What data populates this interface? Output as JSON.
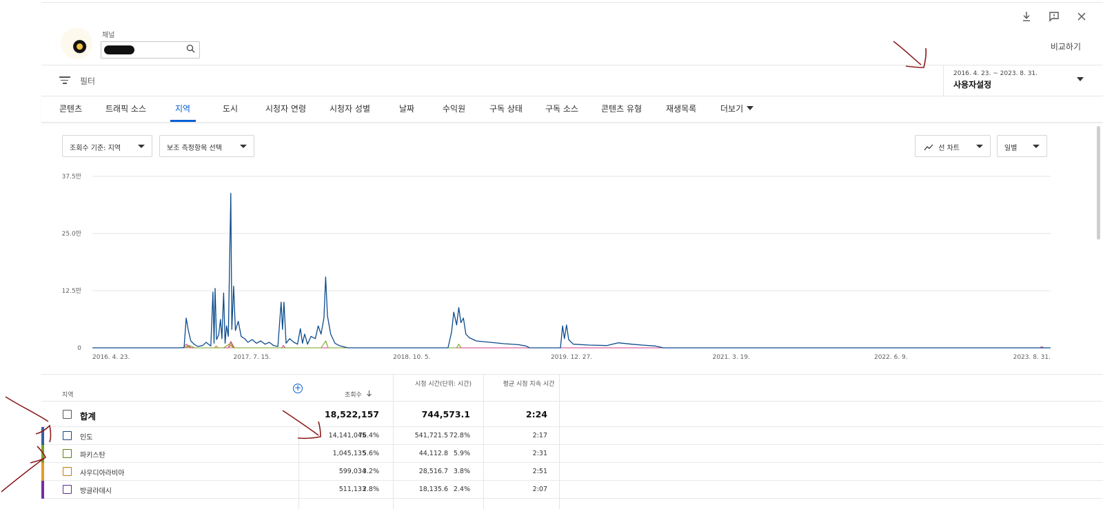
{
  "toolbar": {
    "download_icon": "download-icon",
    "feedback_icon": "feedback-icon",
    "close_icon": "close-icon"
  },
  "channel": {
    "label": "채널",
    "search_icon": "search-icon"
  },
  "compare_label": "비교하기",
  "filter": {
    "label": "필터"
  },
  "date_range": {
    "range": "2016. 4. 23. ~ 2023. 8. 31.",
    "preset": "사용자설정"
  },
  "tabs": [
    {
      "label": "콘텐츠"
    },
    {
      "label": "트래픽 소스"
    },
    {
      "label": "지역"
    },
    {
      "label": "도시"
    },
    {
      "label": "시청자 연령"
    },
    {
      "label": "시청자 성별"
    },
    {
      "label": "날짜"
    },
    {
      "label": "수익원"
    },
    {
      "label": "구독 상태"
    },
    {
      "label": "구독 소스"
    },
    {
      "label": "콘텐츠 유형"
    },
    {
      "label": "재생목록"
    },
    {
      "label": "더보기"
    }
  ],
  "active_tab": "지역",
  "controls": {
    "metric_select": "조회수 기준: 지역",
    "secondary_select": "보조 측정항목 선택",
    "chart_type_select": "선 차트",
    "interval_select": "일별"
  },
  "chart_data": {
    "type": "line",
    "y_ticks": [
      "0",
      "12.5만",
      "25.0만",
      "37.5만"
    ],
    "ylim": [
      0,
      375000
    ],
    "x_ticks": [
      "2016. 4. 23.",
      "2017. 7. 15.",
      "2018. 10. 5.",
      "2019. 12. 27.",
      "2021. 3. 19.",
      "2022. 6. 9.",
      "2023. 8. 31."
    ],
    "xlim": [
      "2016-04-23",
      "2023-08-31"
    ],
    "grid": true,
    "series": [
      {
        "color": "#0b4a8c",
        "points": [
          [
            "2016-04-23",
            0
          ],
          [
            "2016-12-20",
            0
          ],
          [
            "2017-01-05",
            500
          ],
          [
            "2017-01-11",
            65000
          ],
          [
            "2017-01-17",
            38000
          ],
          [
            "2017-01-24",
            15000
          ],
          [
            "2017-02-02",
            8000
          ],
          [
            "2017-02-12",
            3000
          ],
          [
            "2017-02-26",
            5000
          ],
          [
            "2017-03-08",
            12000
          ],
          [
            "2017-03-16",
            7000
          ],
          [
            "2017-03-21",
            4000
          ],
          [
            "2017-03-27",
            122000
          ],
          [
            "2017-03-30",
            10000
          ],
          [
            "2017-04-02",
            130000
          ],
          [
            "2017-04-06",
            18000
          ],
          [
            "2017-04-12",
            28000
          ],
          [
            "2017-04-17",
            62000
          ],
          [
            "2017-04-21",
            20000
          ],
          [
            "2017-04-26",
            120000
          ],
          [
            "2017-04-30",
            10000
          ],
          [
            "2017-05-04",
            48000
          ],
          [
            "2017-05-09",
            25000
          ],
          [
            "2017-05-16",
            338000
          ],
          [
            "2017-05-19",
            40000
          ],
          [
            "2017-05-24",
            135000
          ],
          [
            "2017-05-29",
            38000
          ],
          [
            "2017-06-06",
            58000
          ],
          [
            "2017-06-14",
            25000
          ],
          [
            "2017-06-24",
            20000
          ],
          [
            "2017-07-03",
            12000
          ],
          [
            "2017-07-15",
            18000
          ],
          [
            "2017-07-27",
            10000
          ],
          [
            "2017-08-08",
            15000
          ],
          [
            "2017-08-20",
            8000
          ],
          [
            "2017-09-01",
            12000
          ],
          [
            "2017-09-13",
            5000
          ],
          [
            "2017-09-25",
            3000
          ],
          [
            "2017-10-04",
            100000
          ],
          [
            "2017-10-08",
            40000
          ],
          [
            "2017-10-12",
            100000
          ],
          [
            "2017-10-18",
            10000
          ],
          [
            "2017-10-28",
            20000
          ],
          [
            "2017-11-09",
            12000
          ],
          [
            "2017-11-19",
            8000
          ],
          [
            "2017-11-27",
            42000
          ],
          [
            "2017-12-03",
            10000
          ],
          [
            "2017-12-09",
            30000
          ],
          [
            "2017-12-17",
            8000
          ],
          [
            "2017-12-27",
            25000
          ],
          [
            "2018-01-08",
            20000
          ],
          [
            "2018-01-16",
            48000
          ],
          [
            "2018-01-24",
            30000
          ],
          [
            "2018-02-01",
            65000
          ],
          [
            "2018-02-06",
            155000
          ],
          [
            "2018-02-11",
            70000
          ],
          [
            "2018-02-20",
            30000
          ],
          [
            "2018-03-04",
            10000
          ],
          [
            "2018-03-16",
            5000
          ],
          [
            "2018-03-30",
            2000
          ],
          [
            "2018-04-10",
            0
          ],
          [
            "2019-01-15",
            0
          ],
          [
            "2019-01-25",
            35000
          ],
          [
            "2019-01-31",
            78000
          ],
          [
            "2019-02-08",
            50000
          ],
          [
            "2019-02-14",
            88000
          ],
          [
            "2019-02-20",
            55000
          ],
          [
            "2019-02-27",
            65000
          ],
          [
            "2019-03-06",
            30000
          ],
          [
            "2019-03-16",
            22000
          ],
          [
            "2019-04-04",
            15000
          ],
          [
            "2019-05-13",
            12000
          ],
          [
            "2019-06-21",
            9000
          ],
          [
            "2019-07-31",
            7000
          ],
          [
            "2019-08-21",
            4000
          ],
          [
            "2019-09-01",
            0
          ],
          [
            "2019-11-26",
            0
          ],
          [
            "2019-12-02",
            48000
          ],
          [
            "2019-12-07",
            20000
          ],
          [
            "2019-12-13",
            50000
          ],
          [
            "2019-12-19",
            18000
          ],
          [
            "2020-01-01",
            8000
          ],
          [
            "2020-02-14",
            6000
          ],
          [
            "2020-04-04",
            5000
          ],
          [
            "2020-05-06",
            11000
          ],
          [
            "2020-06-12",
            8000
          ],
          [
            "2020-07-12",
            6000
          ],
          [
            "2020-08-17",
            4000
          ],
          [
            "2020-09-10",
            0
          ],
          [
            "2023-08-31",
            0
          ]
        ]
      },
      {
        "color": "#7aa21f",
        "points": [
          [
            "2017-01-11",
            0
          ],
          [
            "2017-01-20",
            5000
          ],
          [
            "2017-02-04",
            0
          ],
          [
            "2017-04-26",
            0
          ],
          [
            "2017-05-16",
            10000
          ],
          [
            "2017-05-24",
            0
          ],
          [
            "2018-01-24",
            0
          ],
          [
            "2018-02-06",
            15000
          ],
          [
            "2018-02-13",
            0
          ],
          [
            "2019-02-08",
            0
          ],
          [
            "2019-02-14",
            8000
          ],
          [
            "2019-02-21",
            0
          ]
        ]
      },
      {
        "color": "#d33f8a",
        "points": [
          [
            "2017-01-03",
            0
          ],
          [
            "2017-01-11",
            8000
          ],
          [
            "2017-01-25",
            0
          ],
          [
            "2017-05-09",
            0
          ],
          [
            "2017-05-16",
            14000
          ],
          [
            "2017-05-26",
            0
          ],
          [
            "2017-10-06",
            0
          ],
          [
            "2017-10-10",
            5000
          ],
          [
            "2017-10-16",
            0
          ],
          [
            "2023-08-01",
            0
          ],
          [
            "2023-08-06",
            2500
          ],
          [
            "2023-08-12",
            0
          ]
        ]
      },
      {
        "color": "#e07b1f",
        "points": [
          [
            "2017-01-06",
            0
          ],
          [
            "2017-01-14",
            4000
          ],
          [
            "2017-01-22",
            0
          ],
          [
            "2017-03-31",
            0
          ],
          [
            "2017-04-05",
            4000
          ],
          [
            "2017-04-11",
            0
          ],
          [
            "2017-05-11",
            0
          ],
          [
            "2017-05-16",
            6000
          ],
          [
            "2017-05-22",
            0
          ]
        ]
      }
    ]
  },
  "table": {
    "headers": {
      "dimension": "지역",
      "views": "조회수",
      "watch_time": "시청 시간(단위: 시간)",
      "avg_duration": "평균 시청 지속 시간"
    },
    "sort_icon": "arrow-down-icon",
    "add_icon": "add-circle-icon",
    "total": {
      "name": "합계",
      "views": "18,522,157",
      "watch_time": "744,573.1",
      "avg_duration": "2:24"
    },
    "rows": [
      {
        "name": "인도",
        "views": "14,141,045",
        "views_pct": "76.4%",
        "watch_time": "541,721.5",
        "watch_pct": "72.8%",
        "avg_duration": "2:17",
        "color": "#1a4480",
        "swatch": "#3b5ca8"
      },
      {
        "name": "파키스탄",
        "views": "1,045,135",
        "views_pct": "5.6%",
        "watch_time": "44,112.8",
        "watch_pct": "5.9%",
        "avg_duration": "2:31",
        "color": "#5a7d14",
        "swatch": "#7aa21f"
      },
      {
        "name": "사우디아라비아",
        "views": "599,034",
        "views_pct": "3.2%",
        "watch_time": "28,516.7",
        "watch_pct": "3.8%",
        "avg_duration": "2:51",
        "color": "#c07a17",
        "swatch": "#e39b25"
      },
      {
        "name": "방글라데시",
        "views": "511,133",
        "views_pct": "2.8%",
        "watch_time": "18,135.6",
        "watch_pct": "2.4%",
        "avg_duration": "2:07",
        "color": "#5b2a8a",
        "swatch": "#6f2fa6"
      }
    ]
  }
}
